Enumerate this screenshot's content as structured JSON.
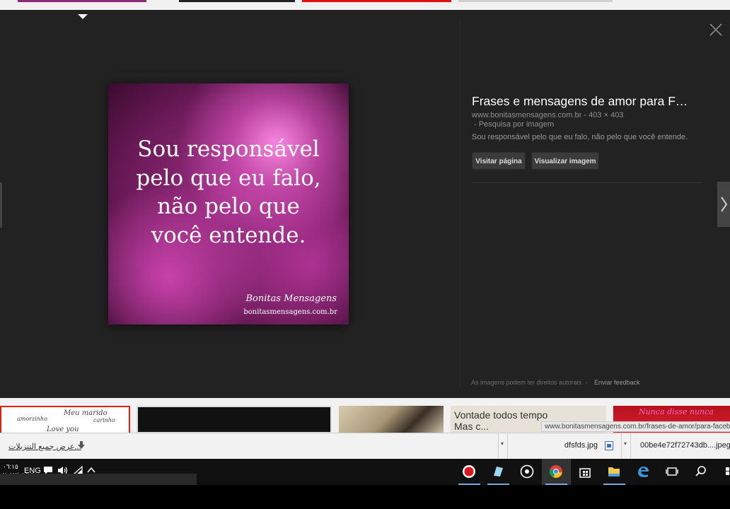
{
  "viewer": {
    "quote_lines": [
      "Sou responsável",
      "pelo que eu falo,",
      "não pelo que",
      "você entende."
    ],
    "brand_name": "Bonitas Mensagens",
    "brand_url": "bonitasmensagens.com.br"
  },
  "info": {
    "title": "Frases e mensagens de amor para F…",
    "meta": "www.bonitasmensagens.com.br - 403 × 403",
    "search_by_image": "- Pesquisa por imagem",
    "description": "Sou responsável pelo que eu falo, não pelo que você entende.",
    "visit_label": "Visitar página",
    "view_label": "Visualizar imagem",
    "copyright_note": "As imagens podem ter direitos autorais.  -",
    "feedback_label": "Enviar feedback"
  },
  "thumbnails": {
    "t1_texts": [
      "Meu marido",
      "amorzinho",
      "Love you",
      "carinho"
    ],
    "t4_text": "Vontade todos tempo",
    "t4_text2": "Mas c...",
    "t5_text": "Nunca disse nunca"
  },
  "status_url": "www.bonitasmensagens.com.br/frases-de-amor/para-facebook",
  "downloads": {
    "show_all": "عرض جميع التنزيلات...",
    "items": [
      {
        "name": "dfsfds.jpg"
      },
      {
        "name": "00be4e72f72743db....jpeg"
      }
    ]
  },
  "taskbar": {
    "time": "٠٦:١٥",
    "date": "٢٠١٧/٠١/١٥",
    "language": "ENG"
  },
  "colors": {
    "panel_bg": "#222222",
    "chrome_active": "#7aa7e0",
    "record_red": "#e0141c"
  }
}
